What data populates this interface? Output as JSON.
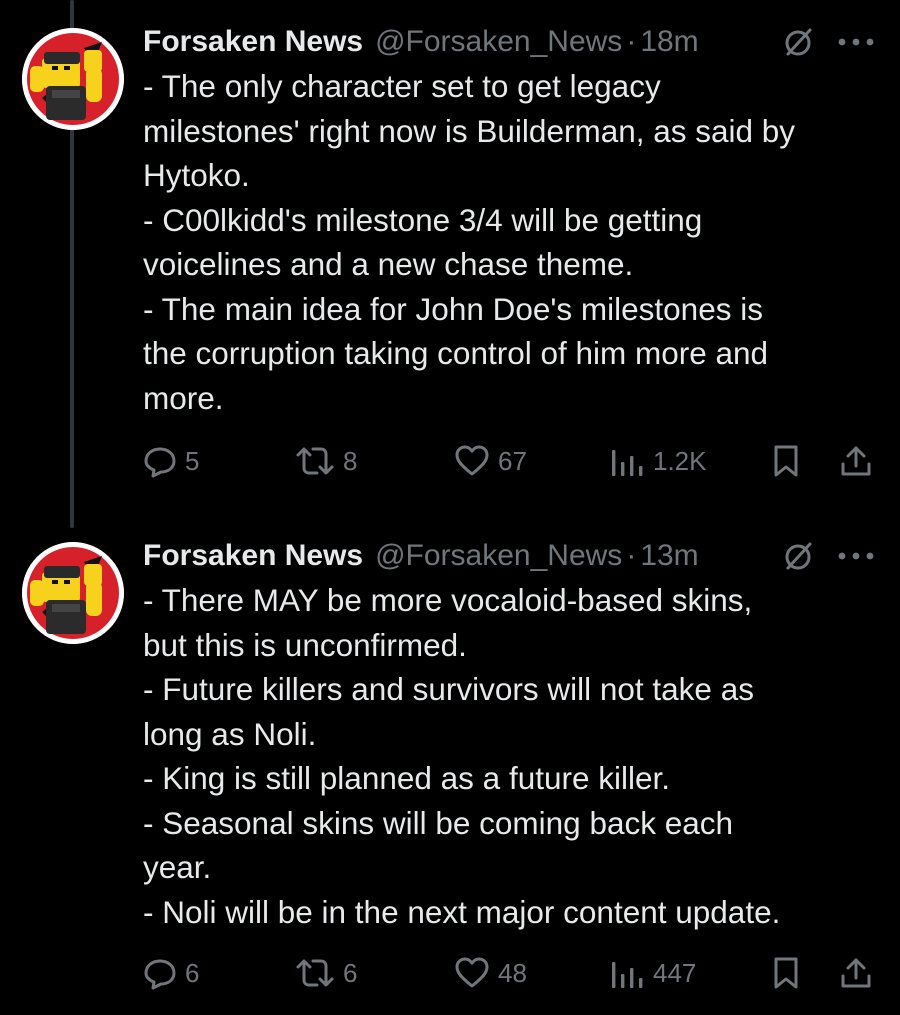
{
  "tweets": [
    {
      "author_name": "Forsaken News",
      "handle": "@Forsaken_News",
      "separator": "·",
      "time": "18m",
      "lines": [
        "- The only character set to get legacy",
        "milestones' right now is Builderman, as said by",
        "Hytoko.",
        "- C00lkidd's milestone 3/4 will be getting",
        "voicelines and a new chase theme.",
        "- The main idea for John Doe's milestones is",
        "the corruption taking control of him more and",
        "more."
      ],
      "replies": "5",
      "reposts": "8",
      "likes": "67",
      "views": "1.2K"
    },
    {
      "author_name": "Forsaken News",
      "handle": "@Forsaken_News",
      "separator": "·",
      "time": "13m",
      "lines": [
        "- There MAY be more vocaloid-based skins,",
        "but this is unconfirmed.",
        "- Future killers and survivors will not take as",
        "long as Noli.",
        "- King is still planned as a future killer.",
        "- Seasonal skins will be coming back each",
        "year.",
        "- Noli will be in the next major content update."
      ],
      "replies": "6",
      "reposts": "6",
      "likes": "48",
      "views": "447"
    }
  ],
  "icons": {
    "reply": "reply-icon",
    "repost": "repost-icon",
    "like": "like-icon",
    "views": "views-icon",
    "bookmark": "bookmark-icon",
    "share": "share-icon",
    "grok": "grok-icon",
    "more": "more-icon"
  },
  "colors": {
    "background": "#000000",
    "text": "#e7e9ea",
    "secondary": "#71767b",
    "thread_line": "#333639",
    "avatar_red": "#d6202a",
    "avatar_yellow": "#f7d21c"
  }
}
